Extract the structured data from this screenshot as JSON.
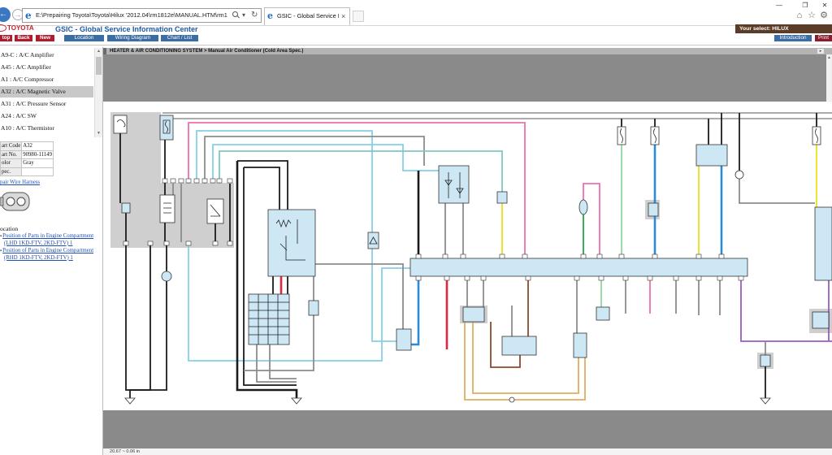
{
  "browser": {
    "address": "E:\\Prepairing Toyota\\Toyota\\Hilux '2012.04\\rm1812e\\MANUAL.HTM\\rm1812e\\ew",
    "tab_title": "GSIC - Global Service Infor..."
  },
  "icons": {
    "back": "←",
    "forward": "→",
    "ie": "e",
    "dropdown": "▾",
    "refresh": "↻",
    "tab_close": "×",
    "minimize": "—",
    "restore": "❐",
    "close": "✕",
    "home": "⌂",
    "favorites": "☆",
    "settings": "⚙",
    "scroll_up": "▲",
    "scroll_down": "▼",
    "bullet": "▪",
    "expand": "▸"
  },
  "header": {
    "brand": "TOYOTA",
    "title": "GSIC - Global Service Information Center",
    "buttons": {
      "stop": "top",
      "back": "Back",
      "new": "New"
    },
    "nav": {
      "location": "Location",
      "wiring": "Wiring Diagram",
      "chart": "Chart / List"
    },
    "select_label": "Your select: HILUX",
    "intro": "Introduction",
    "print": "Print"
  },
  "sidebar": {
    "items": [
      "A9-C : A/C Amplifier",
      "A45 : A/C Amplifier",
      "A1 : A/C Compressor",
      "A32 : A/C Magnetic Valve",
      "A31 : A/C Pressure Sensor",
      "A24 : A/C SW",
      "A10 : A/C Thermistor"
    ],
    "info": [
      {
        "label": "art Code",
        "value": "A32"
      },
      {
        "label": "art No.",
        "value": "90980-11149"
      },
      {
        "label": "olor",
        "value": "Gray"
      },
      {
        "label": "pec.",
        "value": ""
      }
    ],
    "wire_harness_link": "pair Wire Harness",
    "location_heading": "ocation",
    "location_links": [
      {
        "line1": "Position of Parts in Engine Compartment",
        "line2": "(LHD 1KD-FTV, 2KD-FTV) 1"
      },
      {
        "line1": "Position of Parts in Engine Compartment",
        "line2": "(RHD 1KD-FTV, 2KD-FTV) 1"
      }
    ]
  },
  "diagram": {
    "title": "HEATER & AIR CONDITIONING SYSTEM > Manual Air Conditioner (Cold Area Spec.)",
    "status": "20.67 ~ 0.06 in"
  },
  "theme": {
    "brand_red": "#c8202a",
    "nav_blue": "#3a6da3",
    "select_brown": "#5b3c26",
    "button_red": "#b01c2e",
    "link_blue": "#1f4fb0"
  }
}
